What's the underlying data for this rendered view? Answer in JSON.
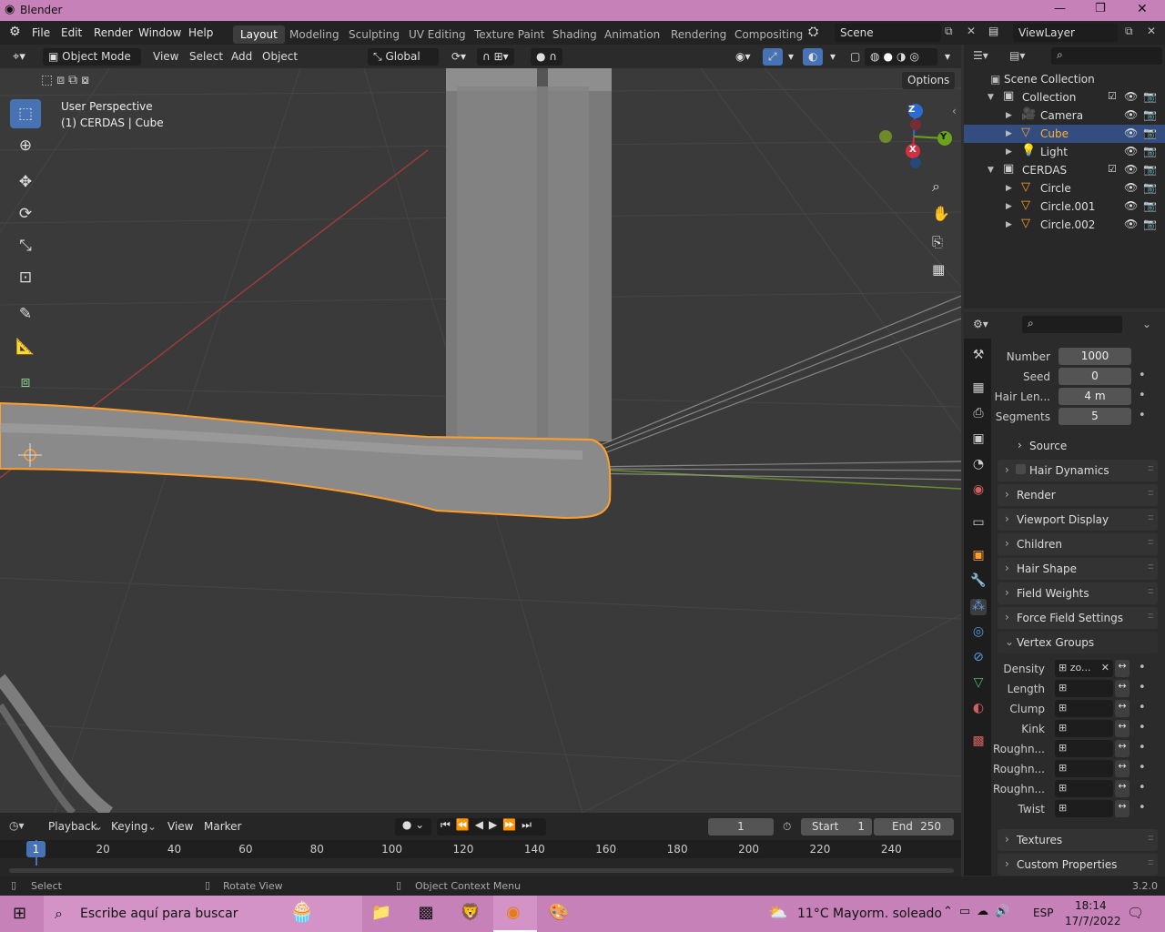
{
  "window": {
    "title": "Blender",
    "controls": [
      "—",
      "❐",
      "✕"
    ]
  },
  "menu": {
    "items": [
      "File",
      "Edit",
      "Render",
      "Window",
      "Help"
    ],
    "workspaces": [
      "Layout",
      "Modeling",
      "Sculpting",
      "UV Editing",
      "Texture Paint",
      "Shading",
      "Animation",
      "Rendering",
      "Compositing"
    ],
    "active_workspace": "Layout",
    "scene": "Scene",
    "view_layer": "ViewLayer"
  },
  "viewport_header": {
    "mode": "Object Mode",
    "menus": [
      "View",
      "Select",
      "Add",
      "Object"
    ],
    "transform": "Global",
    "options": "Options"
  },
  "viewport": {
    "perspective": "User Perspective",
    "context": "(1) CERDAS | Cube",
    "gizmo": {
      "z": "Z",
      "y": "Y",
      "x": "X"
    }
  },
  "outliner": {
    "root": "Scene Collection",
    "rows": [
      {
        "label": "Collection",
        "icon": "collection-icon",
        "indent": 1,
        "expanded": true
      },
      {
        "label": "Camera",
        "icon": "camera-icon",
        "indent": 2
      },
      {
        "label": "Cube",
        "icon": "mesh-icon",
        "indent": 2,
        "selected": true
      },
      {
        "label": "Light",
        "icon": "light-icon",
        "indent": 2
      },
      {
        "label": "CERDAS",
        "icon": "collection-icon",
        "indent": 1,
        "expanded": true
      },
      {
        "label": "Circle",
        "icon": "mesh-icon",
        "indent": 2
      },
      {
        "label": "Circle.001",
        "icon": "mesh-icon",
        "indent": 2
      },
      {
        "label": "Circle.002",
        "icon": "mesh-icon",
        "indent": 2
      }
    ]
  },
  "properties": {
    "emission": [
      {
        "label": "Number",
        "value": "1000"
      },
      {
        "label": "Seed",
        "value": "0"
      },
      {
        "label": "Hair Len...",
        "value": "4 m"
      },
      {
        "label": "Segments",
        "value": "5"
      }
    ],
    "source": "Source",
    "panels": [
      "Hair Dynamics",
      "Render",
      "Viewport Display",
      "Children",
      "Hair Shape",
      "Field Weights",
      "Force Field Settings"
    ],
    "vertex_groups_title": "Vertex Groups",
    "vertex_groups": [
      {
        "label": "Density",
        "value": "zo..."
      },
      {
        "label": "Length",
        "value": ""
      },
      {
        "label": "Clump",
        "value": ""
      },
      {
        "label": "Kink",
        "value": ""
      },
      {
        "label": "Roughn...",
        "value": ""
      },
      {
        "label": "Roughn...",
        "value": ""
      },
      {
        "label": "Roughn...",
        "value": ""
      },
      {
        "label": "Twist",
        "value": ""
      }
    ],
    "bottom_panels": [
      "Textures",
      "Custom Properties"
    ]
  },
  "timeline": {
    "menus": [
      "Playback",
      "Keying",
      "View",
      "Marker"
    ],
    "current_frame": "1",
    "start_label": "Start",
    "start": "1",
    "end_label": "End",
    "end": "250",
    "ticks": [
      "1",
      "20",
      "40",
      "60",
      "80",
      "100",
      "120",
      "140",
      "160",
      "180",
      "200",
      "220",
      "240"
    ]
  },
  "status": {
    "select": "Select",
    "rotate": "Rotate View",
    "context_menu": "Object Context Menu",
    "version": "3.2.0"
  },
  "taskbar": {
    "search_placeholder": "Escribe aquí para buscar",
    "weather": "11°C  Mayorm. soleado",
    "language": "ESP",
    "time": "18:14",
    "date": "17/7/2022"
  },
  "colors": {
    "accent": "#4772b3",
    "selection_outline": "#ff9f29",
    "titlebar": "#c781b9"
  }
}
